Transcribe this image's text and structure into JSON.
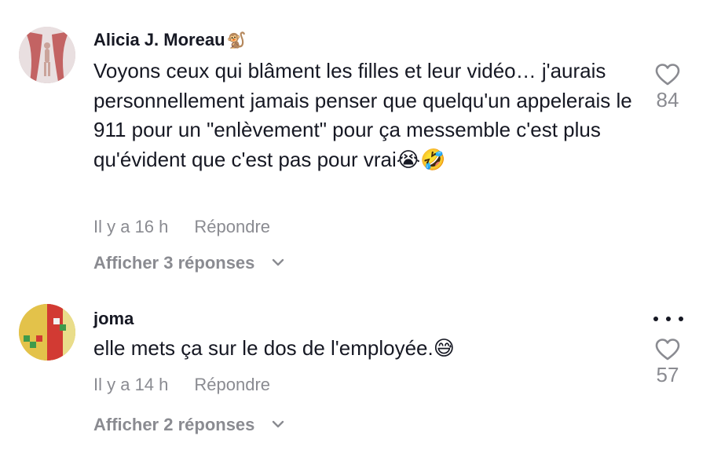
{
  "comments": [
    {
      "username": "Alicia J. Moreau",
      "username_emoji": "🐒",
      "text": "Voyons ceux qui blâment les filles et leur vidéo… j'aurais personnellement jamais penser que quelqu'un appelerais le 911 pour un \"enlèvement\" pour ça messemble c'est plus qu'évident que c'est pas pour vrai😭🤣",
      "time": "Il y a 16 h",
      "reply_label": "Répondre",
      "view_replies": "Afficher 3 réponses",
      "likes": "84",
      "avatar_icon": "profile-photo"
    },
    {
      "username": "joma",
      "username_emoji": "",
      "text": "elle mets ça sur le dos de l'employée.😅",
      "time": "Il y a 14 h",
      "reply_label": "Répondre",
      "view_replies": "Afficher 2 réponses",
      "likes": "57",
      "avatar_icon": "profile-photo"
    }
  ],
  "icons": {
    "like": "heart-outline-icon",
    "more": "more-options-icon",
    "expand": "chevron-down-icon"
  },
  "colors": {
    "text_primary": "#161823",
    "text_secondary": "#8a8b91",
    "background": "#ffffff"
  }
}
